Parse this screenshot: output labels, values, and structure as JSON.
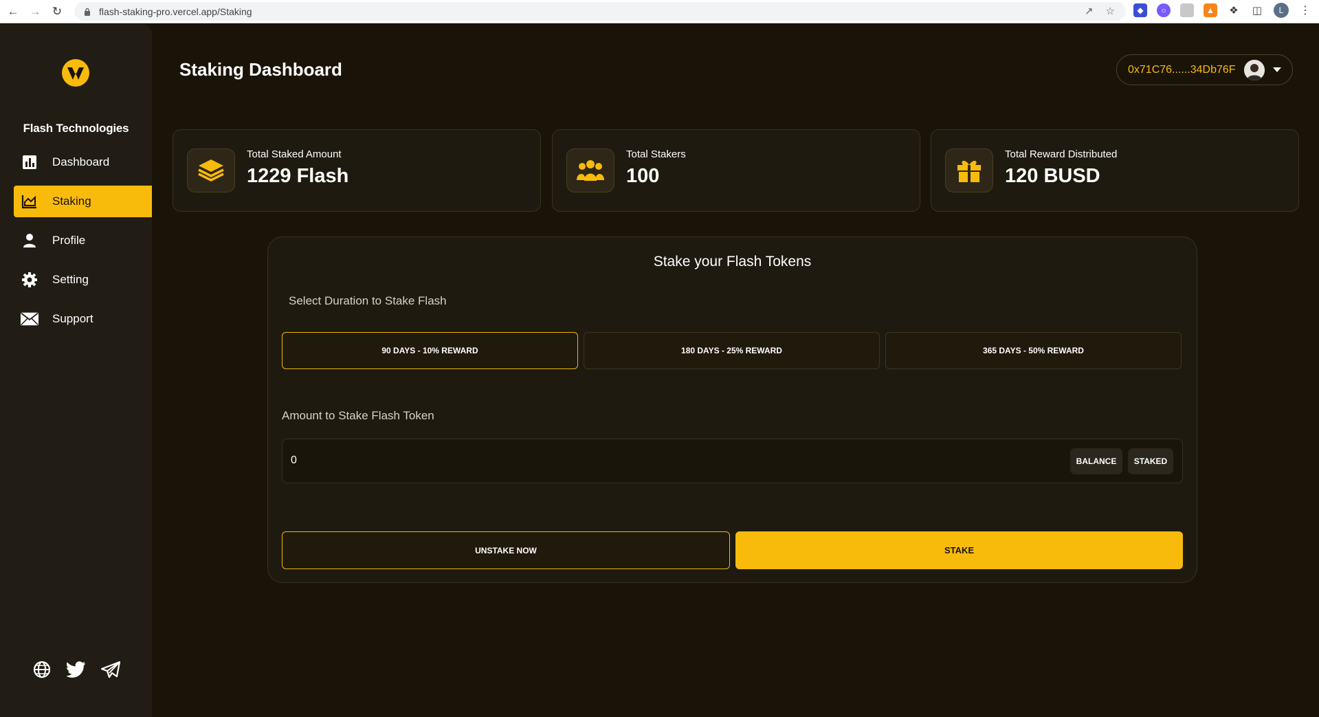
{
  "browser": {
    "url": "flash-staking-pro.vercel.app/Staking",
    "profile_initial": "L"
  },
  "sidebar": {
    "brand": "Flash Technologies",
    "items": [
      {
        "label": "Dashboard",
        "icon": "bar-chart-icon"
      },
      {
        "label": "Staking",
        "icon": "area-chart-icon",
        "active": true
      },
      {
        "label": "Profile",
        "icon": "person-icon"
      },
      {
        "label": "Setting",
        "icon": "gear-icon"
      },
      {
        "label": "Support",
        "icon": "mail-icon"
      }
    ],
    "social": [
      "globe-icon",
      "twitter-icon",
      "telegram-icon"
    ]
  },
  "header": {
    "title": "Staking Dashboard",
    "wallet_address": "0x71C76......34Db76F"
  },
  "stats": [
    {
      "label": "Total Staked Amount",
      "value": "1229 Flash",
      "icon": "layers-icon"
    },
    {
      "label": "Total Stakers",
      "value": "100",
      "icon": "users-icon"
    },
    {
      "label": "Total Reward Distributed",
      "value": "120 BUSD",
      "icon": "gift-icon"
    }
  ],
  "stake": {
    "title": "Stake your Flash Tokens",
    "duration_label": "Select Duration to Stake Flash",
    "durations": [
      {
        "label": "90 DAYS - 10% REWARD",
        "selected": true
      },
      {
        "label": "180 DAYS - 25% REWARD",
        "selected": false
      },
      {
        "label": "365 DAYS - 50% REWARD",
        "selected": false
      }
    ],
    "amount_label": "Amount to Stake Flash Token",
    "amount_value": "0",
    "balance_label": "BALANCE",
    "staked_label": "STAKED",
    "unstake_label": "UNSTAKE NOW",
    "stake_label": "STAKE"
  },
  "colors": {
    "accent": "#f8bb0c",
    "background": "#1a1408",
    "sidebar": "#211d15",
    "card": "#1e1a10"
  }
}
